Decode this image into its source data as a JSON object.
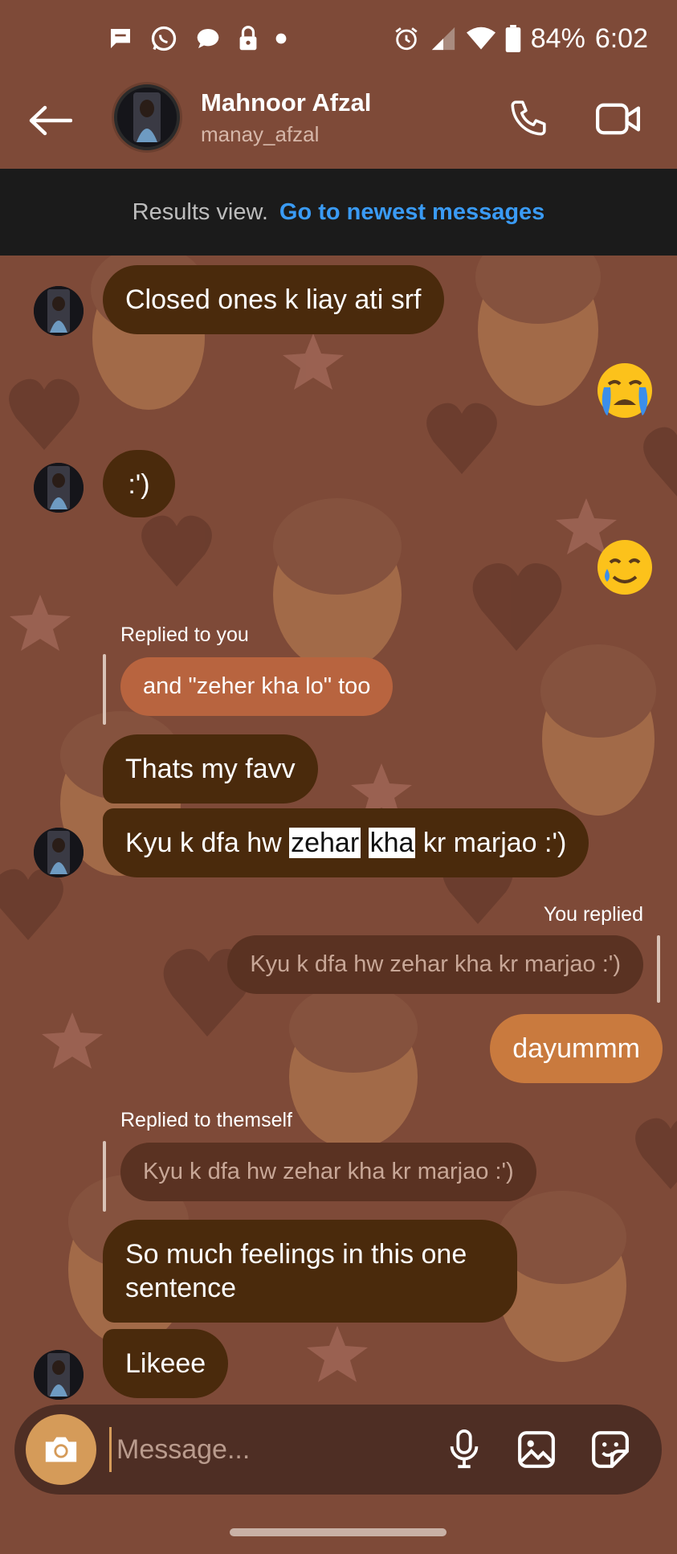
{
  "status_bar": {
    "battery": "84%",
    "time": "6:02",
    "left_icons": [
      "chat-bubble-icon",
      "whatsapp-icon",
      "message-icon",
      "lock-icon",
      "dot-icon"
    ],
    "right_icons": [
      "alarm-icon",
      "signal-icon",
      "wifi-icon",
      "battery-icon"
    ]
  },
  "header": {
    "name": "Mahnoor Afzal",
    "username": "manay_afzal"
  },
  "banner": {
    "text": "Results view.",
    "link": "Go to newest messages"
  },
  "messages": {
    "m1": "Closed ones k liay ati srf",
    "m2": ":')",
    "reply_label_1": "Replied to you",
    "quote_1": "and \"zeher kha lo\" too",
    "m3": "Thats my favv",
    "m4_a": "Kyu k dfa hw ",
    "m4_h1": "zehar",
    "m4_sp": " ",
    "m4_h2": "kha",
    "m4_b": " kr marjao :')",
    "reply_label_2": "You replied",
    "quote_2": "Kyu k dfa hw zehar kha kr marjao :')",
    "m5": "dayummm",
    "reply_label_3": "Replied to themself",
    "quote_3": "Kyu k dfa hw zehar kha kr marjao :')",
    "m6_line1": "So much feelings in this one",
    "m6_line2": "sentence",
    "m7": "Likeee"
  },
  "reactions": [
    "crying-face-emoji",
    "smiling-face-with-tear-emoji"
  ],
  "composer": {
    "placeholder": "Message..."
  },
  "colors": {
    "background": "#7e4a38",
    "received_bubble": "#4a2a0c",
    "sent_bubble": "#c97a3e",
    "quote_bubble_theirs": "#b8643f",
    "quote_bubble_dim": "#5a3222",
    "link": "#3a9bf5",
    "banner": "#1b1b1b",
    "composer": "#4e2e24",
    "camera_button": "#d59b59"
  }
}
